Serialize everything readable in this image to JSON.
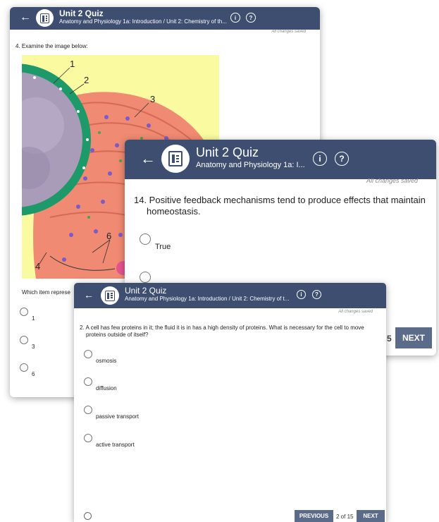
{
  "header": {
    "title": "Unit 2 Quiz",
    "course_full": "Anatomy and Physiology 1a: Introduction / Unit 2: Chemistry of th...",
    "course_mid": "Anatomy and Physiology 1a: I...",
    "course_front": "Anatomy and Physiology 1a: Introduction / Unit 2: Chemistry of t...",
    "info_symbol": "i",
    "help_symbol": "?",
    "back_symbol": "←"
  },
  "save_status": "All changes saved",
  "back_window": {
    "question": "4. Examine the image below:",
    "prompt": "Which item represe",
    "options": [
      "1",
      "3",
      "6"
    ],
    "figure_labels": [
      "1",
      "2",
      "3",
      "4",
      "6"
    ]
  },
  "middle_window": {
    "question": "14. Positive feedback mechanisms tend to produce effects that maintain homeostasis.",
    "options": [
      "True"
    ],
    "page_fragment": "5",
    "next_label": "NEXT"
  },
  "front_window": {
    "question": "2. A cell has few proteins in it; the fluid it is in has a high density of proteins. What is necessary for the cell to move proteins outside of itself?",
    "options": [
      "osmosis",
      "diffusion",
      "passive transport",
      "active transport"
    ],
    "prev_label": "PREVIOUS",
    "page_indicator": "2 of 15",
    "next_label": "NEXT"
  },
  "colors": {
    "header": "#3d4e70",
    "button": "#5b6b8a",
    "figure_bg": "#fafaa0",
    "nucleus_envelope": "#1e9a6a",
    "er": "#f08a72"
  }
}
